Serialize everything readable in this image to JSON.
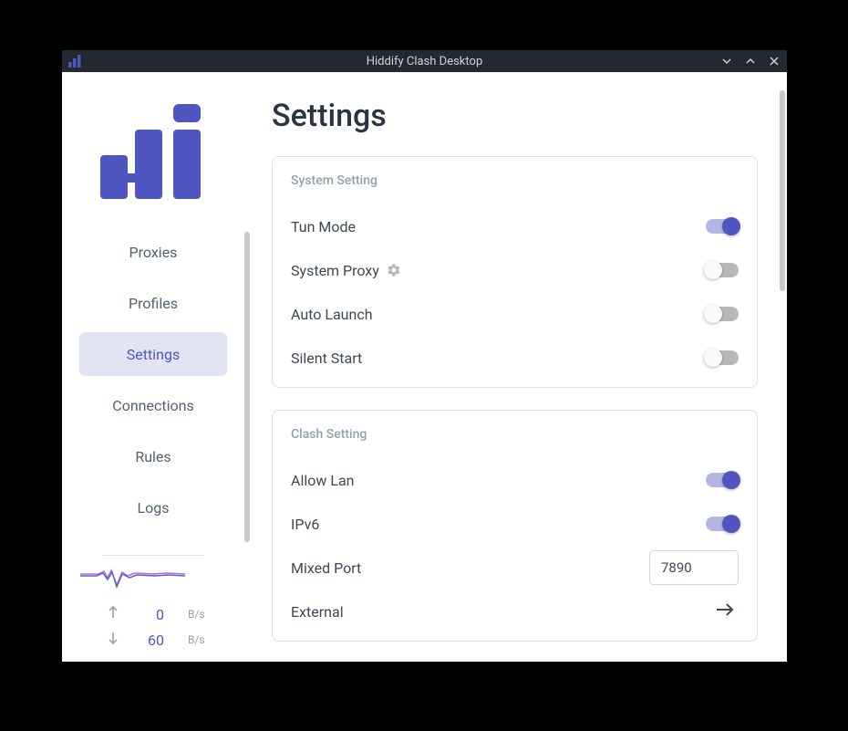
{
  "window": {
    "title": "Hiddify Clash Desktop"
  },
  "sidebar": {
    "items": [
      {
        "label": "Proxies"
      },
      {
        "label": "Profiles"
      },
      {
        "label": "Settings"
      },
      {
        "label": "Connections"
      },
      {
        "label": "Rules"
      },
      {
        "label": "Logs"
      }
    ],
    "active_index": 2,
    "stats": {
      "up_value": "0",
      "up_unit": "B/s",
      "down_value": "60",
      "down_unit": "B/s"
    }
  },
  "page": {
    "title": "Settings",
    "cards": [
      {
        "title": "System Setting",
        "rows": [
          {
            "label": "Tun Mode",
            "control": "toggle",
            "on": true
          },
          {
            "label": "System Proxy",
            "gear": true,
            "control": "toggle",
            "on": false
          },
          {
            "label": "Auto Launch",
            "control": "toggle",
            "on": false
          },
          {
            "label": "Silent Start",
            "control": "toggle",
            "on": false
          }
        ]
      },
      {
        "title": "Clash Setting",
        "rows": [
          {
            "label": "Allow Lan",
            "control": "toggle",
            "on": true
          },
          {
            "label": "IPv6",
            "control": "toggle",
            "on": true
          },
          {
            "label": "Mixed Port",
            "control": "input",
            "value": "7890"
          },
          {
            "label": "External",
            "control": "arrow"
          }
        ]
      }
    ]
  }
}
